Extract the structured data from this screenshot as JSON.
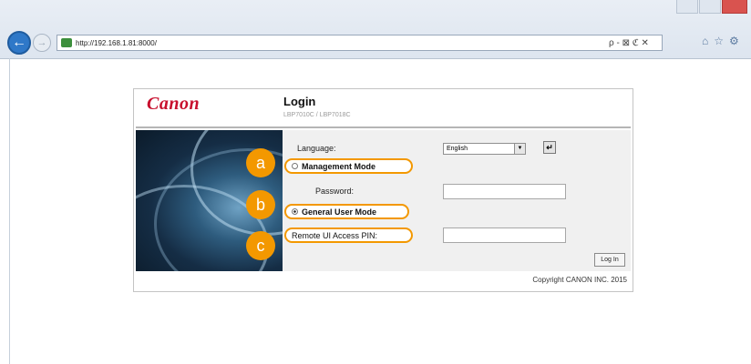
{
  "browser": {
    "url": "http://192.168.1.81:8000/",
    "address_tools": "ρ - ⊠ ℭ ✕",
    "right_icons": [
      "home-icon",
      "favorites-icon",
      "tools-icon"
    ]
  },
  "panel": {
    "logo": "Canon",
    "title": "Login",
    "model": "LBP7010C / LBP7018C"
  },
  "form": {
    "language_label": "Language:",
    "language_value": "English",
    "management_mode_label": "Management Mode",
    "password_label": "Password:",
    "general_user_mode_label": "General User Mode",
    "remote_ui_pin_label": "Remote UI Access PIN:",
    "login_button": "Log In"
  },
  "callouts": {
    "a": "a",
    "b": "b",
    "c": "c"
  },
  "footer": {
    "copyright": "Copyright CANON INC. 2015"
  },
  "colors": {
    "accent": "#f39800",
    "canon_red": "#c8102e"
  }
}
